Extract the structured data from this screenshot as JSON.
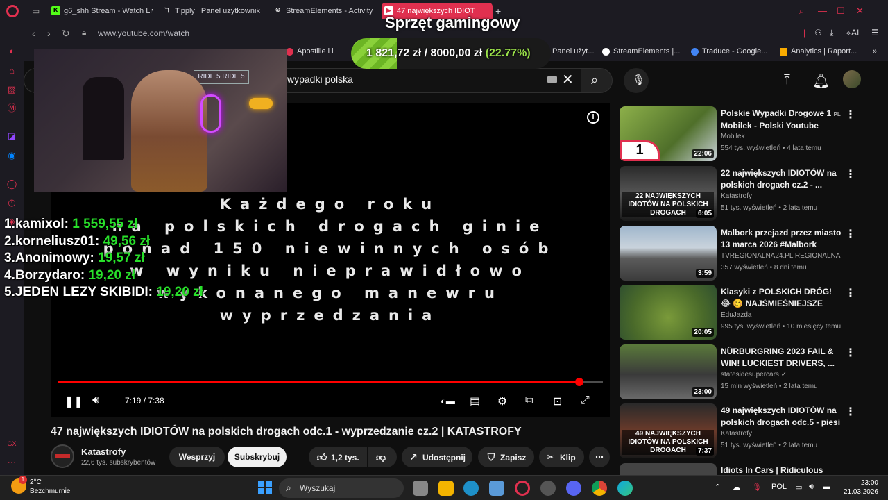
{
  "browser": {
    "tabs": [
      {
        "title": "g6_shh Stream - Watch Liv",
        "icon": "kick-icon",
        "color": "#53fc18"
      },
      {
        "title": "Tipply | Panel użytkownik",
        "icon": "tipply-icon",
        "color": "#ffffff"
      },
      {
        "title": "StreamElements - Activity",
        "icon": "streamelements-icon",
        "color": "#ffffff"
      },
      {
        "title": "47 największych IDIOT",
        "icon": "youtube-icon",
        "color": "#ff0000",
        "active": true
      }
    ],
    "new_tab": "+",
    "url": "www.youtube.com/watch",
    "ai_label": "AI",
    "bookmarks": [
      {
        "label": "Apostille i l",
        "color": "#e0304f"
      },
      {
        "label": "Panel użyt...",
        "color": "#ffffff"
      },
      {
        "label": "StreamElements |...",
        "color": "#ffffff"
      },
      {
        "label": "Traduce - Google...",
        "color": "#4285f4"
      },
      {
        "label": "Analytics | Raport...",
        "color": "#f9ab00"
      }
    ]
  },
  "youtube": {
    "search_value": "wypadki polska",
    "video": {
      "title": "47 największych IDIOTÓW na polskich drogach odc.1 - wyprzedzanie cz.2 | KATASTROFY",
      "overlay_lines": [
        "Każdego roku",
        "na polskich drogach ginie",
        "ponad 150 niewinnych osób",
        "w wyniku nieprawidłowo",
        "wykonanego manewru",
        "wyprzedzania"
      ],
      "time": "7:19 / 7:38",
      "progress": 0.9563
    },
    "channel": {
      "name": "Katastrofy",
      "subs": "22,6 tys. subskrybentów"
    },
    "actions": {
      "support": "Wesprzyj",
      "subscribe": "Subskrybuj",
      "likes": "1,2 tys.",
      "share": "Udostępnij",
      "save": "Zapisz",
      "clip": "Klip"
    },
    "recommendations": [
      {
        "title": "Polskie Wypadki Drogowe 1",
        "badge": "PL",
        "channel": "Mobilek - Polski Youtube",
        "channel2": "Mobilek",
        "meta": "554 tys. wyświetleń • 4 lata temu",
        "duration": "22:06"
      },
      {
        "title": "22 największych IDIOTÓW na polskich drogach cz.2 - ...",
        "channel": "Katastrofy",
        "meta": "51 tys. wyświetleń • 2 lata temu",
        "duration": "6:05",
        "thumb_text": "22 NAJWIĘKSZYCH IDIOTÓW NA POLSKICH DROGACH"
      },
      {
        "title": "Malbork przejazd przez miasto 13 marca 2026 #Malbork",
        "channel": "TVREGIONALNA24.PL REGIONALNA TE...",
        "meta": "357 wyświetleń • 8 dni temu",
        "duration": "3:59"
      },
      {
        "title": "Klasyki z POLSKICH DRÓG! 😂 🥴 NAJŚMIEŚNIEJSZE Wpadk...",
        "channel": "EduJazda",
        "meta": "995 tys. wyświetleń • 10 miesięcy temu",
        "duration": "20:05"
      },
      {
        "title": "NÜRBURGRING 2023 FAIL & WIN! LUCKIEST DRIVERS, ...",
        "channel": "statesidesupercars ✓",
        "meta": "15 mln wyświetleń • 2 lata temu",
        "duration": "23:00"
      },
      {
        "title": "49 największych IDIOTÓW na polskich drogach odc.5 - piesi ...",
        "channel": "Katastrofy",
        "meta": "51 tys. wyświetleń • 2 lata temu",
        "duration": "7:37",
        "thumb_text": "49 NAJWIĘKSZYCH IDIOTÓW NA POLSKICH DROGACH"
      },
      {
        "title": "Idiots In Cars | Ridiculous Driver",
        "channel": "",
        "meta": "",
        "duration": ""
      }
    ]
  },
  "stream_overlay": {
    "goal_title": "Sprzęt gamingowy",
    "goal_current": "1 821,72 zł",
    "goal_target": "/ 8000,00 zł",
    "goal_percent": "(22.77%)",
    "goal_progress": 0.2277,
    "leaderboard": [
      {
        "rank": "1.",
        "name": "kamixol:",
        "amount": "1 559,55 zł"
      },
      {
        "rank": "2.",
        "name": "korneliusz01:",
        "amount": "49,56 zł"
      },
      {
        "rank": "3.",
        "name": "Anonimowy:",
        "amount": "19,57 zł"
      },
      {
        "rank": "4.",
        "name": "Borzydaro:",
        "amount": "19,20 zł"
      },
      {
        "rank": "5.",
        "name": "JEDEN LEZY SKIBIDI:",
        "amount": "19,20 zł"
      }
    ],
    "webcam_sign": "RIDE 5 RIDE 5"
  },
  "taskbar": {
    "temp": "2°C",
    "weather": "Bezchmurnie",
    "search": "Wyszukaj",
    "lang": "POL",
    "time": "23:00",
    "date": "21.03.2026"
  }
}
